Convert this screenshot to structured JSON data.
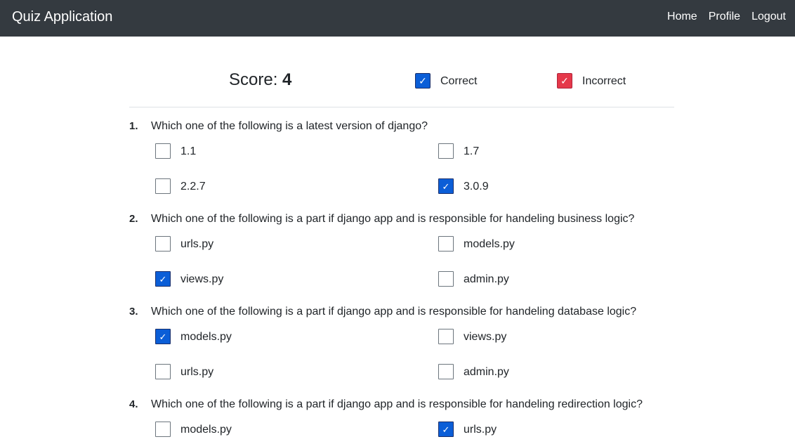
{
  "navbar": {
    "brand": "Quiz Application",
    "links": [
      "Home",
      "Profile",
      "Logout"
    ]
  },
  "score": {
    "label": "Score:",
    "value": "4"
  },
  "legend": {
    "correct": {
      "label": "Correct",
      "color": "#0b5ed7"
    },
    "incorrect": {
      "label": "Incorrect",
      "color": "#e5384a"
    }
  },
  "questions": [
    {
      "number": "1.",
      "text": "Which one of the following is a latest version of django?",
      "options": [
        {
          "label": "1.1",
          "checked": false
        },
        {
          "label": "1.7",
          "checked": false
        },
        {
          "label": "2.2.7",
          "checked": false
        },
        {
          "label": "3.0.9",
          "checked": true
        }
      ]
    },
    {
      "number": "2.",
      "text": "Which one of the following is a part if django app and is responsible for handeling business logic?",
      "options": [
        {
          "label": "urls.py",
          "checked": false
        },
        {
          "label": "models.py",
          "checked": false
        },
        {
          "label": "views.py",
          "checked": true
        },
        {
          "label": "admin.py",
          "checked": false
        }
      ]
    },
    {
      "number": "3.",
      "text": "Which one of the following is a part if django app and is responsible for handeling database logic?",
      "options": [
        {
          "label": "models.py",
          "checked": true
        },
        {
          "label": "views.py",
          "checked": false
        },
        {
          "label": "urls.py",
          "checked": false
        },
        {
          "label": "admin.py",
          "checked": false
        }
      ]
    },
    {
      "number": "4.",
      "text": "Which one of the following is a part if django app and is responsible for handeling redirection logic?",
      "options": [
        {
          "label": "models.py",
          "checked": false
        },
        {
          "label": "urls.py",
          "checked": true
        }
      ]
    }
  ]
}
